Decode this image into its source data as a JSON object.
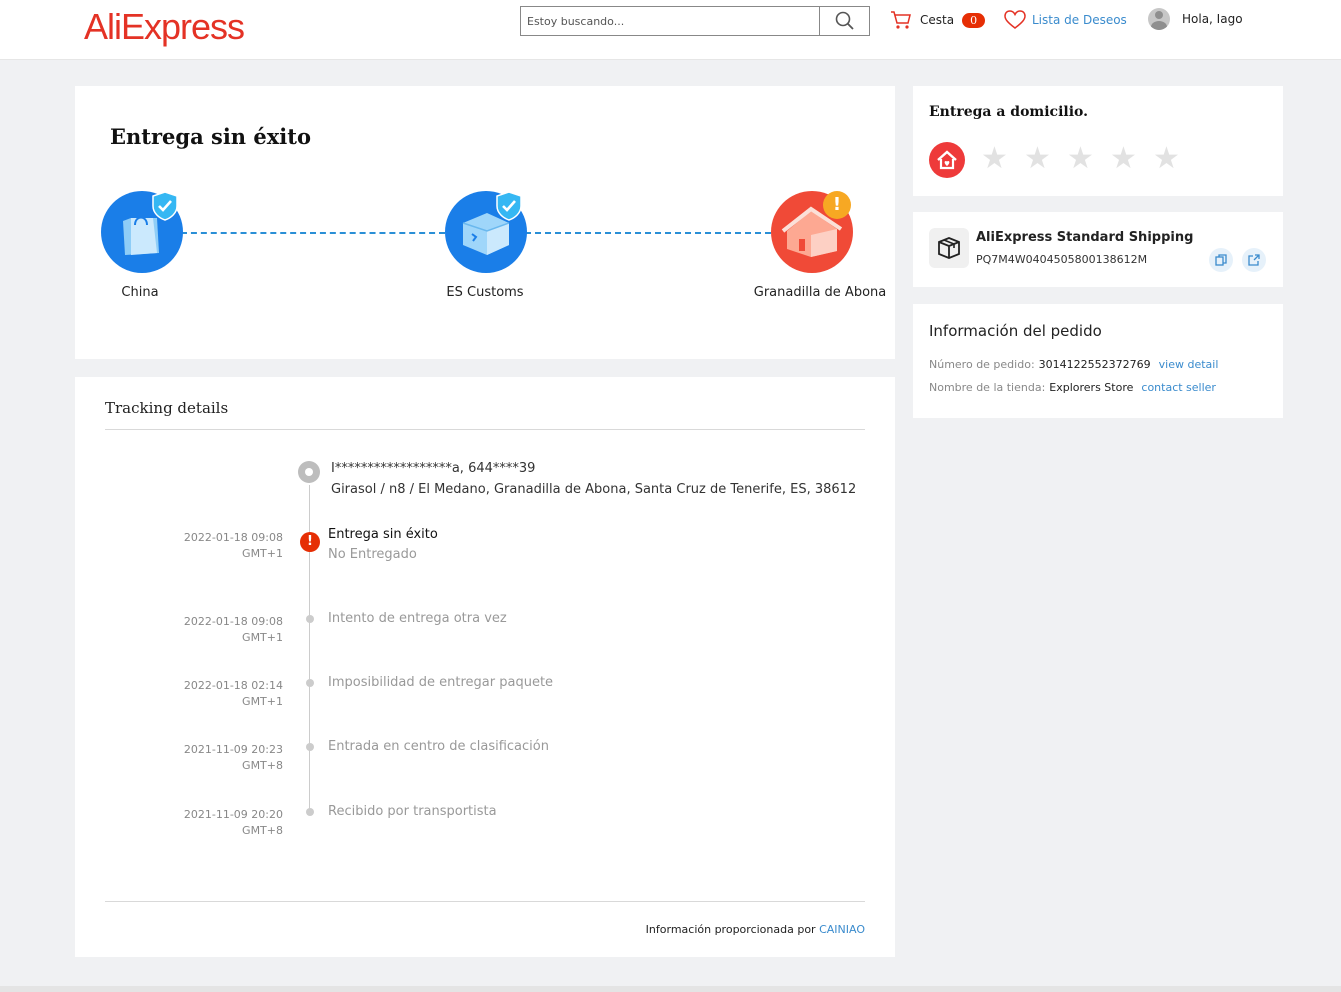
{
  "header": {
    "logo_text": "AliExpress",
    "search_placeholder": "Estoy buscando...",
    "cart_label": "Cesta",
    "cart_count": "0",
    "wishlist_label": "Lista de Deseos",
    "greeting": "Hola, Iago"
  },
  "status": {
    "title": "Entrega sin éxito",
    "nodes": [
      {
        "label": "China",
        "icon": "shopping-bag-icon",
        "state": "done"
      },
      {
        "label": "ES Customs",
        "icon": "package-icon",
        "state": "done"
      },
      {
        "label": "Granadilla de Abona",
        "icon": "house-icon",
        "state": "warning"
      }
    ]
  },
  "tracking": {
    "title": "Tracking details",
    "address_line1": "I******************a,  644****39",
    "address_line2": "Girasol / n8 / El Medano,  Granadilla de Abona,  Santa Cruz de Tenerife,  ES,  38612",
    "events": [
      {
        "date": "2022-01-18 09:08",
        "tz": "GMT+1",
        "text": "Entrega sin éxito",
        "sub": "No Entregado",
        "alert": true
      },
      {
        "date": "2022-01-18 09:08",
        "tz": "GMT+1",
        "text": "Intento de entrega otra vez"
      },
      {
        "date": "2022-01-18 02:14",
        "tz": "GMT+1",
        "text": "Imposibilidad de entregar paquete"
      },
      {
        "date": "2021-11-09 20:23",
        "tz": "GMT+8",
        "text": "Entrada en centro de clasificación"
      },
      {
        "date": "2021-11-09 20:20",
        "tz": "GMT+8",
        "text": "Recibido por transportista"
      }
    ],
    "provider_prefix": "Información proporcionada por",
    "provider_name": "CAINIAO"
  },
  "delivery": {
    "title": "Entrega a domicilio.",
    "rating": 0,
    "max_rating": 5
  },
  "shipping": {
    "method": "AliExpress Standard Shipping",
    "tracking_number": "PQ7M4W0404505800138612M"
  },
  "order_info": {
    "title": "Información del pedido",
    "order_number_label": "Número de pedido:",
    "order_number": "3014122552372769",
    "view_detail": "view detail",
    "store_label": "Nombre de la tienda:",
    "store_name": "Explorers Store",
    "contact_seller": "contact seller"
  },
  "colors": {
    "brand": "#e43225",
    "link": "#3a8bcd",
    "node_blue": "#1a7ee8",
    "node_red": "#f04a37",
    "warning": "#f7a823",
    "alert": "#e62e04"
  }
}
